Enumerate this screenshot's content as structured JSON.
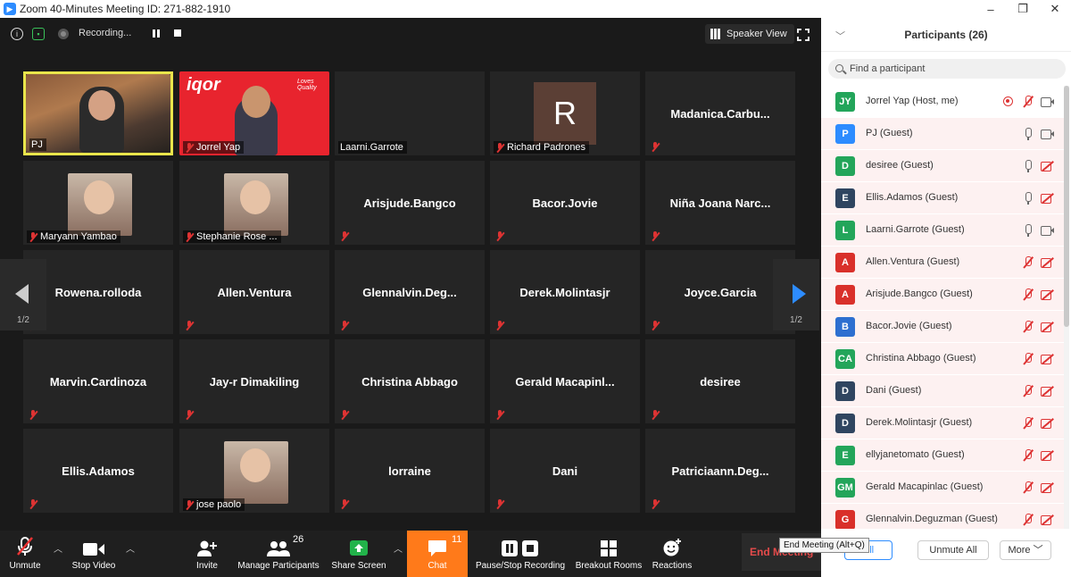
{
  "window": {
    "title": "Zoom 40-Minutes Meeting ID: 271-882-1910",
    "controls": [
      "–",
      "❐",
      "✕"
    ]
  },
  "top_bar": {
    "recording_text": "Recording...",
    "speaker_view_label": "Speaker View"
  },
  "tiles": [
    {
      "name": "PJ",
      "type": "video",
      "muted": false,
      "active": true
    },
    {
      "name": "Jorrel Yap",
      "type": "video",
      "muted": true,
      "brand": "iqor",
      "brand_tag": "Loves Quality"
    },
    {
      "name": "Laarni.Garrote",
      "type": "label",
      "muted": false
    },
    {
      "name": "Richard Padrones",
      "type": "avatar",
      "avatar_letter": "R",
      "muted": true
    },
    {
      "name": "Madanica.Carbu...",
      "type": "name",
      "muted": true
    },
    {
      "name": "Maryann Yambao",
      "type": "photo",
      "muted": true
    },
    {
      "name": "Stephanie Rose ...",
      "type": "photo",
      "muted": true
    },
    {
      "name": "Arisjude.Bangco",
      "type": "name",
      "muted": true
    },
    {
      "name": "Bacor.Jovie",
      "type": "name",
      "muted": true
    },
    {
      "name": "Niña Joana Narc...",
      "type": "name",
      "muted": true
    },
    {
      "name": "Rowena.rolloda",
      "type": "name",
      "muted": true
    },
    {
      "name": "Allen.Ventura",
      "type": "name",
      "muted": true
    },
    {
      "name": "Glennalvin.Deg...",
      "type": "name",
      "muted": true
    },
    {
      "name": "Derek.Molintasjr",
      "type": "name",
      "muted": true
    },
    {
      "name": "Joyce.Garcia",
      "type": "name",
      "muted": true
    },
    {
      "name": "Marvin.Cardinoza",
      "type": "name",
      "muted": true
    },
    {
      "name": "Jay-r Dimakiling",
      "type": "name",
      "muted": true
    },
    {
      "name": "Christina Abbago",
      "type": "name",
      "muted": true
    },
    {
      "name": "Gerald  Macapinl...",
      "type": "name",
      "muted": true
    },
    {
      "name": "desiree",
      "type": "name",
      "muted": true
    },
    {
      "name": "Ellis.Adamos",
      "type": "name",
      "muted": true
    },
    {
      "name": "jose paolo",
      "type": "photo",
      "muted": true
    },
    {
      "name": "lorraine",
      "type": "name",
      "muted": true
    },
    {
      "name": "Dani",
      "type": "name",
      "muted": true
    },
    {
      "name": "Patriciaann.Deg...",
      "type": "name",
      "muted": true
    }
  ],
  "pager": {
    "left": "1/2",
    "right": "1/2"
  },
  "toolbar": {
    "unmute": "Unmute",
    "stop_video": "Stop Video",
    "invite": "Invite",
    "manage_participants": "Manage Participants",
    "participant_count": "26",
    "share_screen": "Share Screen",
    "chat": "Chat",
    "chat_count": "11",
    "record": "Pause/Stop Recording",
    "breakout": "Breakout Rooms",
    "reactions": "Reactions",
    "end_meeting": "End Meeting",
    "tooltip": "End Meeting (Alt+Q)"
  },
  "panel": {
    "title": "Participants (26)",
    "search_placeholder": "Find a participant",
    "participants": [
      {
        "initials": "JY",
        "name": "Jorrel Yap (Host, me)",
        "color": "#23a55a",
        "mic": "off",
        "cam": "on",
        "recording": true
      },
      {
        "initials": "P",
        "name": "PJ (Guest)",
        "color": "#2d8cff",
        "mic": "on",
        "cam": "on"
      },
      {
        "initials": "D",
        "name": "desiree (Guest)",
        "color": "#23a55a",
        "mic": "on",
        "cam": "off"
      },
      {
        "initials": "E",
        "name": "Ellis.Adamos (Guest)",
        "color": "#2f4560",
        "mic": "on",
        "cam": "off"
      },
      {
        "initials": "L",
        "name": "Laarni.Garrote (Guest)",
        "color": "#23a55a",
        "mic": "on",
        "cam": "on"
      },
      {
        "initials": "A",
        "name": "Allen.Ventura (Guest)",
        "color": "#d9302a",
        "mic": "off",
        "cam": "off"
      },
      {
        "initials": "A",
        "name": "Arisjude.Bangco (Guest)",
        "color": "#d9302a",
        "mic": "off",
        "cam": "off"
      },
      {
        "initials": "B",
        "name": "Bacor.Jovie (Guest)",
        "color": "#2d6fd0",
        "mic": "off",
        "cam": "off"
      },
      {
        "initials": "CA",
        "name": "Christina Abbago (Guest)",
        "color": "#23a55a",
        "mic": "off",
        "cam": "off"
      },
      {
        "initials": "D",
        "name": "Dani (Guest)",
        "color": "#2f4560",
        "mic": "off",
        "cam": "off"
      },
      {
        "initials": "D",
        "name": "Derek.Molintasjr (Guest)",
        "color": "#2f4560",
        "mic": "off",
        "cam": "off"
      },
      {
        "initials": "E",
        "name": "ellyjanetomato (Guest)",
        "color": "#23a55a",
        "mic": "off",
        "cam": "off"
      },
      {
        "initials": "GM",
        "name": "Gerald Macapinlac (Guest)",
        "color": "#23a55a",
        "mic": "off",
        "cam": "off"
      },
      {
        "initials": "G",
        "name": "Glennalvin.Deguzman (Guest)",
        "color": "#d9302a",
        "mic": "off",
        "cam": "off"
      }
    ],
    "footer": {
      "mute_all": "All",
      "unmute_all": "Unmute All",
      "more": "More"
    }
  }
}
